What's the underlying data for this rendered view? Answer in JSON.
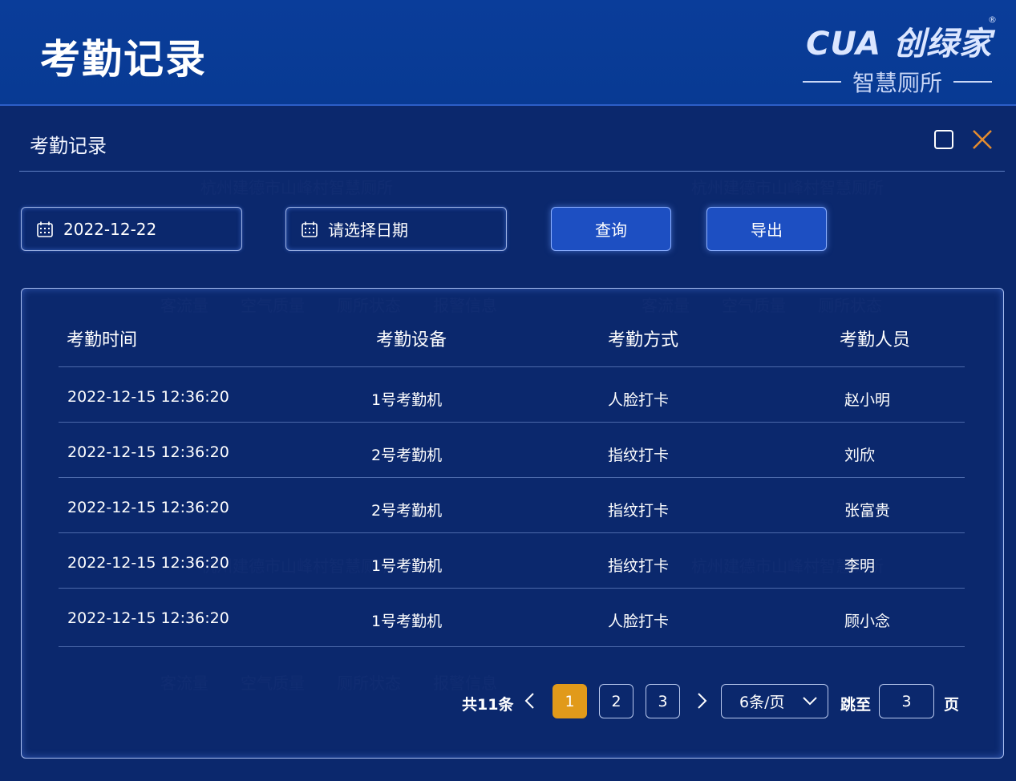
{
  "header": {
    "title": "考勤记录",
    "brand_logo": "CUA 创绿家",
    "brand_sub": "智慧厕所"
  },
  "dialog": {
    "title": "考勤记录"
  },
  "filters": {
    "start_date": "2022-12-22",
    "end_date_placeholder": "请选择日期",
    "query_label": "查询",
    "export_label": "导出"
  },
  "table": {
    "columns": [
      "考勤时间",
      "考勤设备",
      "考勤方式",
      "考勤人员"
    ],
    "rows": [
      [
        "2022-12-15  12:36:20",
        "1号考勤机",
        "人脸打卡",
        "赵小明"
      ],
      [
        "2022-12-15  12:36:20",
        "2号考勤机",
        "指纹打卡",
        "刘欣"
      ],
      [
        "2022-12-15  12:36:20",
        "2号考勤机",
        "指纹打卡",
        "张富贵"
      ],
      [
        "2022-12-15  12:36:20",
        "1号考勤机",
        "指纹打卡",
        "李明"
      ],
      [
        "2022-12-15  12:36:20",
        "1号考勤机",
        "人脸打卡",
        "顾小念"
      ]
    ]
  },
  "pagination": {
    "total": "共11条",
    "pages": [
      "1",
      "2",
      "3"
    ],
    "current": "1",
    "page_size": "6条/页",
    "jump_label": "跳至",
    "jump_value": "3",
    "jump_suffix": "页"
  },
  "colors": {
    "accent": "#1d4fc2",
    "active_page": "#e19a1a",
    "close_icon": "#e58c2e"
  },
  "icons": [
    "calendar-icon",
    "maximize-icon",
    "close-icon",
    "chevron-left-icon",
    "chevron-right-icon",
    "chevron-down-icon"
  ]
}
